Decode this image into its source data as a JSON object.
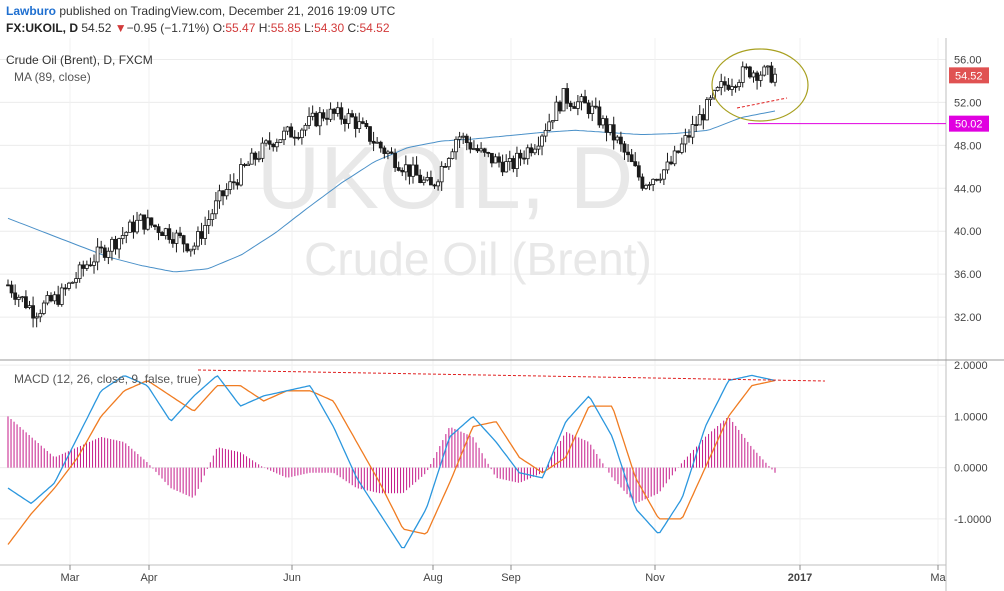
{
  "header": {
    "author": "Lawburo",
    "published_text": "published on TradingView.com, December 21, 2016 19:09 UTC",
    "symbol": "FX:UKOIL, D",
    "last": "54.52",
    "change_arrow": "▼",
    "change": "−0.95 (−1.71%)",
    "o_label": "O:",
    "o": "55.47",
    "h_label": "H:",
    "h": "55.85",
    "l_label": "L:",
    "l": "54.30",
    "c_label": "C:",
    "c": "54.52"
  },
  "legend": {
    "title": "Crude Oil (Brent), D, FXCM",
    "ma": "MA (89, close)",
    "macd": "MACD (12, 26, close, 9, false, true)"
  },
  "watermark": {
    "big": "UKOIL, D",
    "small": "Crude Oil (Brent)"
  },
  "price_tags": {
    "last": "54.52",
    "line": "50.02"
  },
  "colors": {
    "up_candle": "#ffffff",
    "down_candle": "#1a1a1a",
    "ma": "#4a90c8",
    "macd_line": "#2b97de",
    "signal_line": "#f07c22",
    "histogram": "#c51b8a",
    "horizontal_line": "#e000e0",
    "trendline": "#e02020",
    "ellipse": "#a8a020",
    "last_tag": "#e05252",
    "line_tag": "#e000e0"
  },
  "chart_data": [
    {
      "type": "candlestick",
      "title": "Crude Oil (Brent), D, FXCM",
      "ylim": [
        28,
        58
      ],
      "y_ticks": [
        "56.00",
        "52.00",
        "48.00",
        "44.00",
        "40.00",
        "36.00",
        "32.00"
      ],
      "x_ticks": [
        "Mar",
        "Apr",
        "Jun",
        "Aug",
        "Sep",
        "Nov",
        "2017",
        "Ma"
      ],
      "series": [
        {
          "name": "MA (89, close)",
          "values": [
            41.2,
            40.0,
            38.8,
            37.6,
            36.8,
            36.2,
            36.5,
            37.8,
            39.8,
            42.2,
            44.5,
            46.5,
            47.8,
            48.4,
            48.6,
            48.9,
            49.2,
            49.4,
            49.2,
            49.0,
            49.1,
            49.4,
            50.6,
            51.2
          ]
        },
        {
          "name": "Close",
          "values": [
            35.0,
            32.5,
            34.0,
            37.0,
            39.0,
            41.0,
            40.0,
            38.5,
            43.0,
            46.0,
            48.5,
            49.5,
            51.0,
            50.5,
            48.0,
            46.0,
            44.0,
            49.0,
            47.0,
            46.0,
            48.5,
            52.5,
            51.5,
            48.5,
            44.5,
            46.0,
            50.0,
            53.5,
            55.0,
            54.5
          ]
        }
      ],
      "horizontal_line": 50.02,
      "last_value": 54.52
    },
    {
      "type": "line",
      "title": "MACD (12, 26, close, 9, false, true)",
      "ylim": [
        -1.9,
        2.1
      ],
      "y_ticks": [
        "2.0000",
        "1.0000",
        "0.0000",
        "-1.0000"
      ],
      "series": [
        {
          "name": "MACD",
          "values": [
            -0.4,
            -0.7,
            -0.3,
            0.6,
            1.5,
            1.8,
            1.6,
            0.9,
            1.4,
            1.8,
            1.2,
            1.4,
            1.5,
            1.6,
            0.8,
            -0.2,
            -0.9,
            -1.6,
            -0.8,
            0.6,
            1.0,
            0.5,
            -0.1,
            -0.2,
            0.9,
            1.4,
            0.6,
            -0.8,
            -1.3,
            -0.6,
            0.8,
            1.7,
            1.8,
            1.7
          ]
        },
        {
          "name": "Signal",
          "values": [
            -1.5,
            -0.9,
            -0.4,
            0.2,
            1.0,
            1.5,
            1.7,
            1.4,
            1.1,
            1.6,
            1.6,
            1.3,
            1.5,
            1.5,
            1.3,
            0.5,
            -0.3,
            -1.2,
            -1.3,
            -0.3,
            0.8,
            0.9,
            0.2,
            -0.1,
            0.2,
            1.2,
            1.2,
            -0.2,
            -1.0,
            -1.0,
            0.0,
            1.0,
            1.6,
            1.7
          ]
        },
        {
          "name": "Histogram",
          "values": [
            1.0,
            0.6,
            0.2,
            0.4,
            0.6,
            0.5,
            0.1,
            -0.4,
            -0.6,
            0.4,
            0.3,
            0.0,
            -0.2,
            -0.1,
            -0.1,
            -0.4,
            -0.5,
            -0.5,
            -0.1,
            0.8,
            0.6,
            -0.2,
            -0.3,
            -0.1,
            0.7,
            0.5,
            -0.2,
            -0.7,
            -0.5,
            0.1,
            0.6,
            1.0,
            0.4,
            -0.1
          ]
        }
      ]
    }
  ]
}
